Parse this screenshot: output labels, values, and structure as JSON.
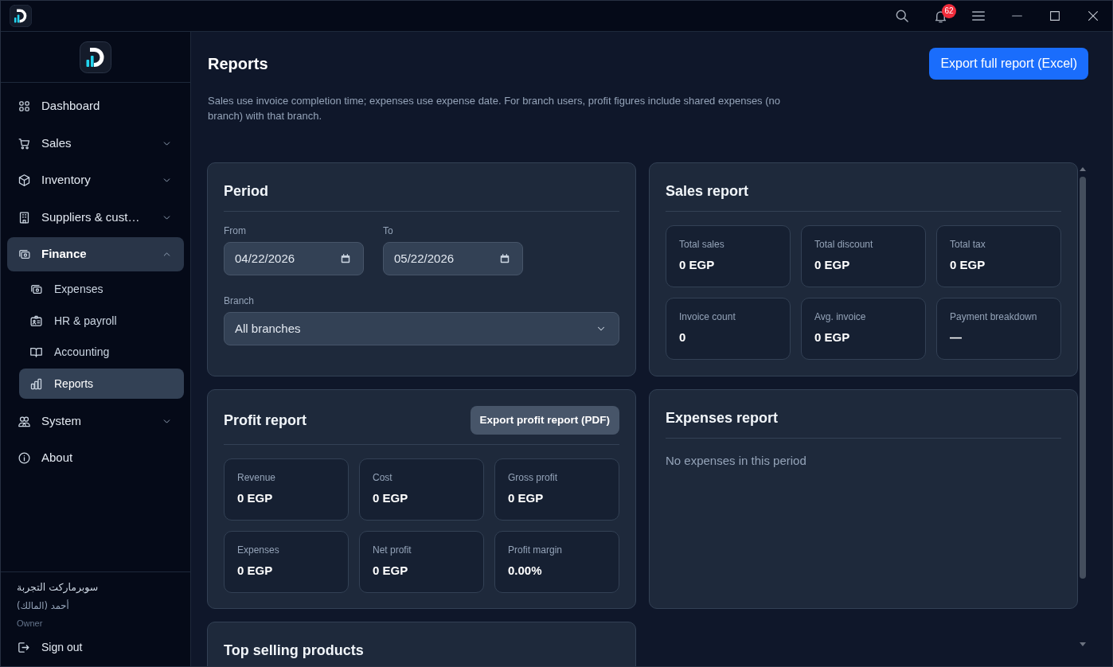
{
  "title_bar": {
    "notification_count": "62"
  },
  "sidebar": {
    "items": [
      {
        "label": "Dashboard",
        "selected": false
      },
      {
        "label": "Sales",
        "selected": false,
        "expanded": false
      },
      {
        "label": "Inventory",
        "selected": false,
        "expanded": false
      },
      {
        "label": "Suppliers & cust…",
        "selected": false,
        "expanded": false
      },
      {
        "label": "Finance",
        "selected": true,
        "expanded": true,
        "children": [
          {
            "label": "Expenses",
            "selected": false
          },
          {
            "label": "HR & payroll",
            "selected": false
          },
          {
            "label": "Accounting",
            "selected": false
          },
          {
            "label": "Reports",
            "selected": true
          }
        ]
      },
      {
        "label": "System",
        "selected": false,
        "expanded": false
      },
      {
        "label": "About",
        "selected": false
      }
    ],
    "account": {
      "store": "سوبرماركت التجربة",
      "user": "أحمد (المالك)",
      "role": "Owner"
    },
    "sign_out": "Sign out"
  },
  "header": {
    "title": "Reports",
    "note": "Sales use invoice completion time; expenses use expense date. For branch users, profit figures include shared expenses (no branch) with that branch.",
    "export_button": "Export full report (Excel)"
  },
  "period": {
    "title": "Period",
    "dates": [
      {
        "label": "From",
        "value": "04/22/2026"
      },
      {
        "label": "To",
        "value": "05/22/2026"
      }
    ],
    "branch": {
      "label": "Branch",
      "value": "All branches"
    }
  },
  "sales_report": {
    "title": "Sales report",
    "stats": [
      {
        "label": "Total sales",
        "value": "0 EGP"
      },
      {
        "label": "Total discount",
        "value": "0 EGP"
      },
      {
        "label": "Total tax",
        "value": "0 EGP"
      },
      {
        "label": "Invoice count",
        "value": "0"
      },
      {
        "label": "Avg. invoice",
        "value": "0 EGP"
      },
      {
        "label": "Payment breakdown",
        "value": "—"
      }
    ]
  },
  "profit_report": {
    "title": "Profit report",
    "export_button": "Export profit report (PDF)",
    "stats": [
      {
        "label": "Revenue",
        "value": "0 EGP"
      },
      {
        "label": "Cost",
        "value": "0 EGP"
      },
      {
        "label": "Gross profit",
        "value": "0 EGP"
      },
      {
        "label": "Expenses",
        "value": "0 EGP"
      },
      {
        "label": "Net profit",
        "value": "0 EGP"
      },
      {
        "label": "Profit margin",
        "value": "0.00%"
      }
    ]
  },
  "expenses_report": {
    "title": "Expenses report",
    "empty_message": "No expenses in this period"
  },
  "top_selling_products": {
    "title": "Top selling products"
  }
}
